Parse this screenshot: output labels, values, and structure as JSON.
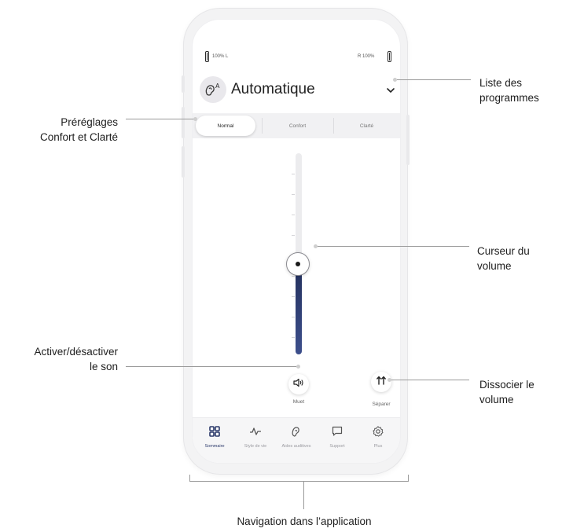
{
  "status": {
    "battery_left": "100% L",
    "battery_right": "R 100%"
  },
  "program": {
    "icon": "ear-a-icon",
    "title": "Automatique",
    "dropdown_icon": "chevron-down-icon"
  },
  "presets": {
    "options": [
      "Normal",
      "Confort",
      "Clarté"
    ],
    "selected": "Normal"
  },
  "volume": {
    "level": 0.45
  },
  "buttons": {
    "mute_label": "Muet",
    "separate_label": "Séparer"
  },
  "nav": {
    "items": [
      {
        "label": "Sommaire",
        "icon": "grid-icon",
        "active": true
      },
      {
        "label": "Style de vie",
        "icon": "activity-icon",
        "active": false
      },
      {
        "label": "Aides auditives",
        "icon": "hearing-aid-icon",
        "active": false
      },
      {
        "label": "Support",
        "icon": "chat-icon",
        "active": false
      },
      {
        "label": "Plus",
        "icon": "gear-icon",
        "active": false
      }
    ]
  },
  "callouts": {
    "programs_list": [
      "Liste des",
      "programmes"
    ],
    "presets": [
      "Préréglages",
      "Confort et Clarté"
    ],
    "volume_slider": [
      "Curseur du",
      "volume"
    ],
    "mute": [
      "Activer/désactiver",
      "le son"
    ],
    "dissociate": [
      "Dissocier le",
      "volume"
    ],
    "navigation": "Navigation dans l’application"
  },
  "colors": {
    "accent": "#2c3a6b",
    "slider_fill": "#3d4f8c"
  }
}
